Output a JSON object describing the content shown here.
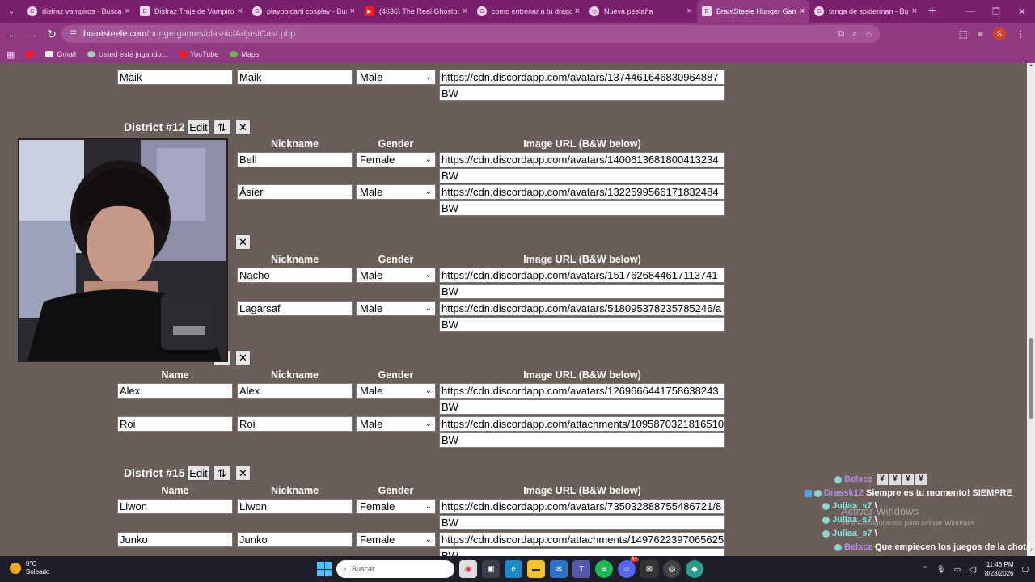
{
  "browser": {
    "tabs": [
      {
        "title": "disfraz vampiros - Buscar",
        "favicon": "G"
      },
      {
        "title": "Disfraz Traje de Vampiro",
        "favicon": "D"
      },
      {
        "title": "playboicarti cosplay - Bus",
        "favicon": "G"
      },
      {
        "title": "(4636) The Real Ghostbust",
        "favicon": "▶"
      },
      {
        "title": "como entrenar a tu drago",
        "favicon": "G"
      },
      {
        "title": "Nueva pestaña",
        "favicon": "◎"
      },
      {
        "title": "BrantSteele Hunger Game",
        "favicon": "B"
      },
      {
        "title": "tanga de spiderman - Bus",
        "favicon": "G"
      }
    ],
    "address": {
      "host": "brantsteele.com",
      "path": "/hungergames/classic/AdjustCast.php"
    },
    "profile_initial": "S",
    "bookmarks": [
      {
        "label": ""
      },
      {
        "label": "Gmail"
      },
      {
        "label": "Usted está jugando..."
      },
      {
        "label": "YouTube"
      },
      {
        "label": "Maps"
      }
    ]
  },
  "cast": {
    "headers": {
      "name": "Name",
      "nickname": "Nickname",
      "gender": "Gender",
      "image_url": "Image URL (B&W below)"
    },
    "buttons": {
      "edit": "Edit",
      "sort": "⇅",
      "delete": "✕"
    },
    "top_rows": [
      {
        "name": "Maik",
        "nickname": "Maik",
        "gender": "Male",
        "url": "https://cdn.discordapp.com/avatars/1374461646830964887",
        "bw": "BW"
      }
    ],
    "district12": {
      "title": "District #12",
      "rows": [
        {
          "nickname": "Bell",
          "gender": "Female",
          "url": "https://cdn.discordapp.com/avatars/1400613681800413234",
          "bw": "BW"
        },
        {
          "nickname": "Åsier",
          "gender": "Male",
          "url": "https://cdn.discordapp.com/avatars/1322599566171832484",
          "bw": "BW"
        }
      ]
    },
    "district13": {
      "rows": [
        {
          "nickname": "Nacho",
          "gender": "Male",
          "url": "https://cdn.discordapp.com/avatars/1517626844617113741",
          "bw": "BW"
        },
        {
          "nickname": "Lagarsaf",
          "gender": "Male",
          "url": "https://cdn.discordapp.com/avatars/518095378235785246/a",
          "bw": "BW"
        }
      ]
    },
    "district14": {
      "rows": [
        {
          "name": "Alex",
          "nickname": "Alex",
          "gender": "Male",
          "url": "https://cdn.discordapp.com/avatars/1269666441758638243",
          "bw": "BW"
        },
        {
          "name": "Roi",
          "nickname": "Roi",
          "gender": "Male",
          "url": "https://cdn.discordapp.com/attachments/1095870321816510",
          "bw": "BW"
        }
      ]
    },
    "district15": {
      "title": "District #15",
      "rows": [
        {
          "name": "Liwon",
          "nickname": "Liwon",
          "gender": "Female",
          "url": "https://cdn.discordapp.com/avatars/735032888755486721/8",
          "bw": "BW"
        },
        {
          "name": "Junko",
          "nickname": "Junko",
          "gender": "Female",
          "url": "https://cdn.discordapp.com/attachments/1497622397065625",
          "bw": "BW"
        }
      ]
    }
  },
  "chat": [
    {
      "user": "Belxcz",
      "message": "",
      "color": "#b98cf0"
    },
    {
      "user": "Drassk12",
      "message": "Siempre es tu momento! SIEMPRE",
      "color": "#b98cf0"
    },
    {
      "user": "Juliaa_s7",
      "message": "\\",
      "color": "#7ee7e7"
    },
    {
      "user": "Juliaa_s7",
      "message": "\\",
      "color": "#7ee7e7"
    },
    {
      "user": "Juliaa_s7",
      "message": "\\",
      "color": "#7ee7e7"
    },
    {
      "user": "Belxcz",
      "message": "Que empiecen los juegos de la chota",
      "color": "#b58cf5"
    }
  ],
  "windows_activation": {
    "title": "Activar Windows",
    "subtitle": "Ve a Configuración para activar Windows."
  },
  "taskbar": {
    "weather_temp": "8°C",
    "weather_desc": "Soleado",
    "search_placeholder": "Buscar",
    "time": "11:46 PM",
    "date": "8/23/2026",
    "notification_badge": "9+"
  },
  "colors": {
    "page_bg": "#6b5e58",
    "tabbar": "#7a1f6e",
    "toolbar": "#8f3a83"
  }
}
